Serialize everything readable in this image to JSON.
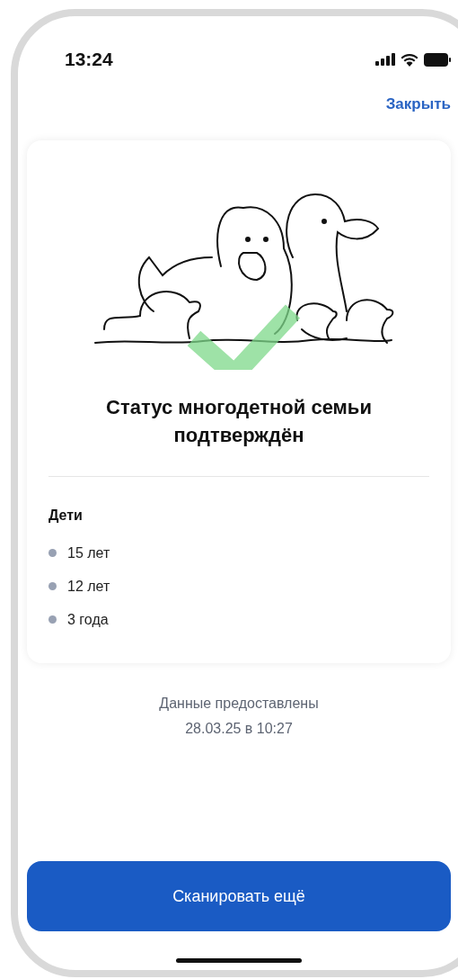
{
  "status_bar": {
    "time": "13:24"
  },
  "close_link": "Закрыть",
  "card": {
    "title": "Статус многодетной семьи подтверждён",
    "section_title": "Дети",
    "children": [
      "15 лет",
      "12 лет",
      "3 года"
    ]
  },
  "footer": {
    "line1": "Данные предоставлены",
    "line2": "28.03.25 в 10:27"
  },
  "button": "Сканировать ещё"
}
